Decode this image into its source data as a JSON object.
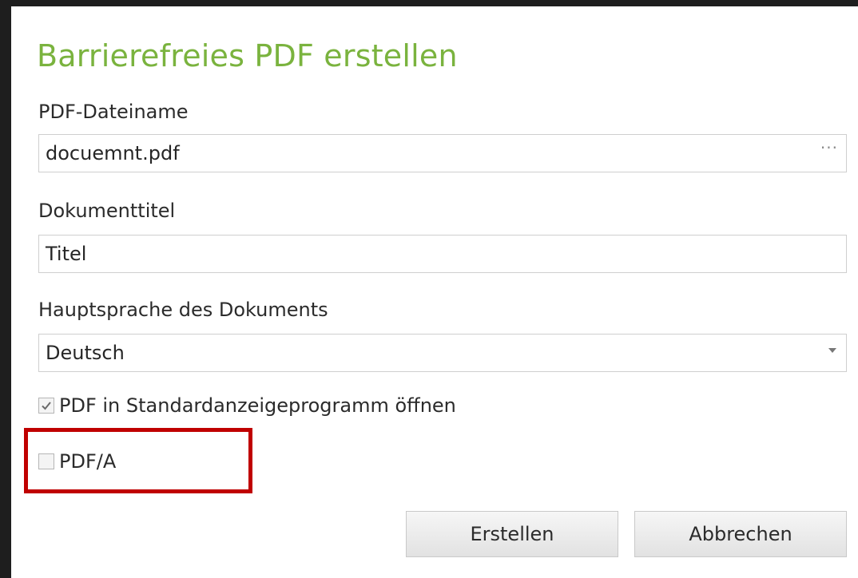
{
  "dialog": {
    "title": "Barrierefreies PDF erstellen",
    "accent_color": "#7ab33e",
    "highlight_color": "#c00000"
  },
  "filename": {
    "label": "PDF-Dateiname",
    "value": "docuemnt.pdf",
    "browse_label": "···"
  },
  "doc_title": {
    "label": "Dokumenttitel",
    "value": "Titel"
  },
  "language": {
    "label": "Hauptsprache des Dokuments",
    "selected": "Deutsch"
  },
  "options": {
    "open_default_viewer": {
      "label": "PDF in Standardanzeigeprogramm öffnen",
      "checked": true
    },
    "pdfa": {
      "label": "PDF/A",
      "checked": false
    }
  },
  "buttons": {
    "create": "Erstellen",
    "cancel": "Abbrechen"
  }
}
